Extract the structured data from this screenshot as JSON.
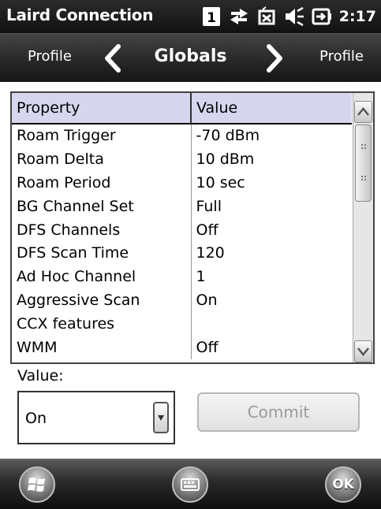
{
  "status_bar": {
    "app_title": "Laird Connection",
    "icons": [
      "sim-1-icon",
      "data-sync-icon",
      "no-sync-icon",
      "volume-mute-icon",
      "battery-charging-icon"
    ],
    "sim_label": "1",
    "time": "2:17"
  },
  "nav": {
    "left_label": "Profile",
    "title": "Globals",
    "right_label": "Profile"
  },
  "grid": {
    "headers": {
      "property": "Property",
      "value": "Value"
    },
    "rows": [
      {
        "property": "Roam Trigger",
        "value": "-70 dBm"
      },
      {
        "property": "Roam Delta",
        "value": "10 dBm"
      },
      {
        "property": "Roam Period",
        "value": "10 sec"
      },
      {
        "property": "BG Channel Set",
        "value": "Full"
      },
      {
        "property": "DFS Channels",
        "value": "Off"
      },
      {
        "property": "DFS Scan Time",
        "value": "120"
      },
      {
        "property": "Ad Hoc Channel",
        "value": "1"
      },
      {
        "property": "Aggressive Scan",
        "value": "On"
      },
      {
        "property": "CCX features",
        "value": ""
      },
      {
        "property": "WMM",
        "value": "Off"
      }
    ]
  },
  "editor": {
    "value_label": "Value:",
    "selected_value": "On",
    "commit_label": "Commit"
  },
  "softkeys": {
    "ok_label": "OK"
  },
  "colors": {
    "header_bg": "#d6d7ef",
    "commit_disabled_text": "#9a9a9a"
  }
}
